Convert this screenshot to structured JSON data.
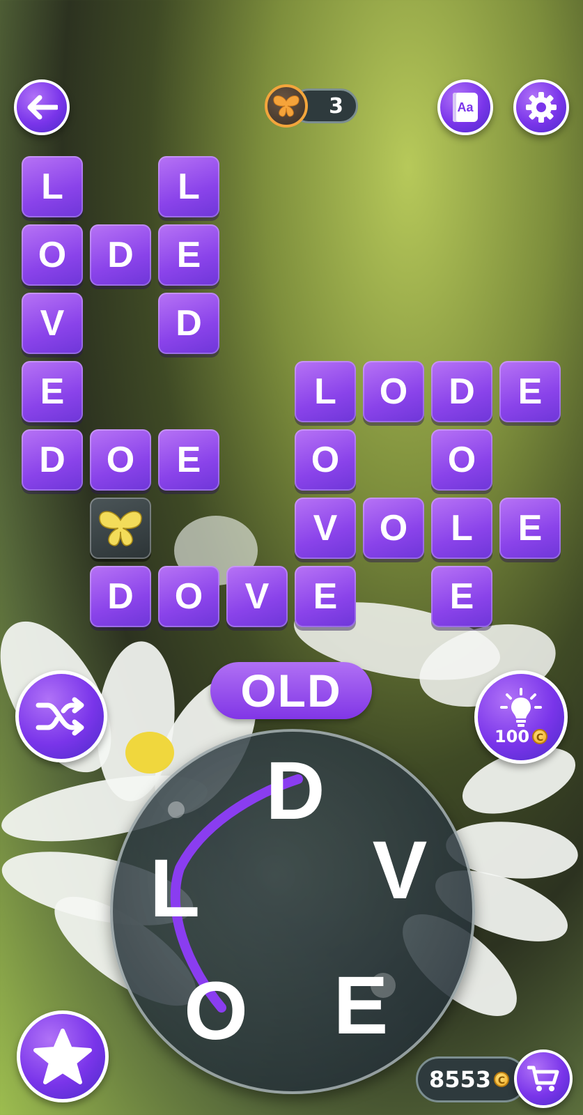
{
  "topbar": {
    "back_icon": "arrow-left-icon",
    "butterfly_count": "3",
    "dictionary_label": "Aa",
    "settings_icon": "gear-icon"
  },
  "grid": {
    "tiles": [
      "L",
      "L",
      "O",
      "D",
      "E",
      "V",
      "D",
      "E",
      "L",
      "O",
      "D",
      "E",
      "D",
      "O",
      "E",
      "O",
      "O",
      "V",
      "O",
      "L",
      "E",
      "D",
      "O",
      "V",
      "E",
      "E"
    ]
  },
  "current_word": "OLD",
  "hint": {
    "cost": "100",
    "coin_symbol": "C"
  },
  "wheel": {
    "letters": [
      "D",
      "L",
      "V",
      "O",
      "E"
    ]
  },
  "coins": {
    "value": "8553",
    "coin_symbol": "C"
  },
  "icons": {
    "shuffle": "shuffle-icon",
    "hint": "lightbulb-icon",
    "star": "star-icon",
    "cart": "cart-icon",
    "butterfly": "butterfly-icon"
  },
  "colors": {
    "tile": "#8a43ea",
    "accent": "#7a35ea",
    "butterfly": "#f5a33a"
  }
}
